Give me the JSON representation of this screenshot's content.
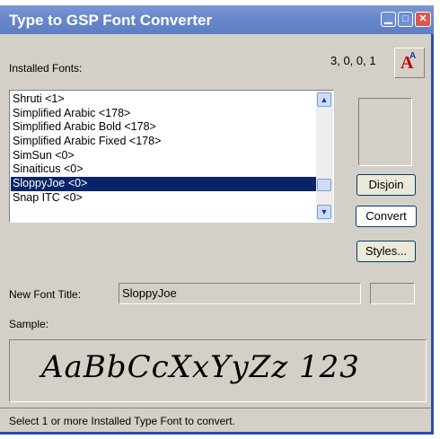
{
  "window": {
    "title": "Type to GSP Font Converter",
    "version": "3, 0, 0, 1"
  },
  "labels": {
    "installed_fonts": "Installed Fonts:",
    "new_font_title": "New Font Title:",
    "sample": "Sample:"
  },
  "fonts": [
    {
      "name": "Shruti <1>",
      "selected": false
    },
    {
      "name": "Simplified Arabic <178>",
      "selected": false
    },
    {
      "name": "Simplified Arabic Bold <178>",
      "selected": false
    },
    {
      "name": "Simplified Arabic Fixed <178>",
      "selected": false
    },
    {
      "name": "SimSun <0>",
      "selected": false
    },
    {
      "name": "Sinaiticus <0>",
      "selected": false
    },
    {
      "name": "SloppyJoe <0>",
      "selected": true
    },
    {
      "name": "Snap ITC <0>",
      "selected": false
    }
  ],
  "buttons": {
    "disjoin": "Disjoin",
    "convert": "Convert",
    "styles": "Styles..."
  },
  "fields": {
    "new_font_title_value": "SloppyJoe",
    "extra_value": ""
  },
  "sample_text": "AaBbCcXxYyZz 123",
  "status": "Select 1 or more Installed Type Font to convert.",
  "icons": {
    "app": "font-converter-icon",
    "minimize": "minimize-icon",
    "maximize": "maximize-icon",
    "close": "close-icon",
    "scroll_up": "scroll-up-arrow-icon",
    "scroll_down": "scroll-down-arrow-icon"
  },
  "colors": {
    "titlebar": "#6a89cc",
    "selection": "#0a246a",
    "window_bg": "#d4d0c8",
    "close_button": "#d8584a"
  }
}
